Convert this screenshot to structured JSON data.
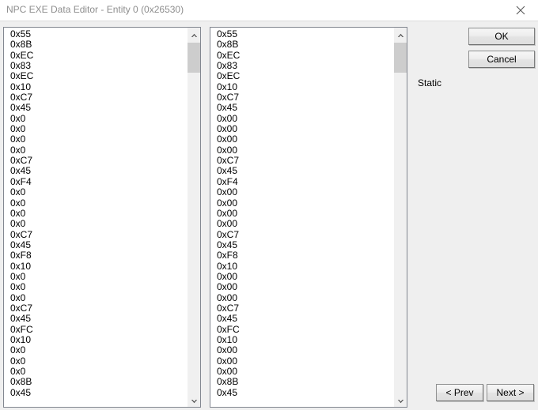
{
  "window": {
    "title": "NPC EXE Data Editor - Entity 0 (0x26530)",
    "close_icon": "close-icon"
  },
  "colors": {
    "window_background": "#efefef",
    "titlebar_background": "#ffffff",
    "title_text": "#8e8e8e",
    "listbox_background": "#ffffff",
    "listbox_border": "#828790",
    "scrollbar_track": "#f0f0f0",
    "scrollbar_thumb": "#cdcdcd",
    "button_face": "#ededed",
    "button_border": "#8e8f8f",
    "text": "#000000"
  },
  "lists": {
    "left": {
      "name": "original-bytes-list",
      "values": [
        "0x55",
        "0x8B",
        "0xEC",
        "0x83",
        "0xEC",
        "0x10",
        "0xC7",
        "0x45",
        "0x0",
        "0x0",
        "0x0",
        "0x0",
        "0xC7",
        "0x45",
        "0xF4",
        "0x0",
        "0x0",
        "0x0",
        "0x0",
        "0xC7",
        "0x45",
        "0xF8",
        "0x10",
        "0x0",
        "0x0",
        "0x0",
        "0xC7",
        "0x45",
        "0xFC",
        "0x10",
        "0x0",
        "0x0",
        "0x0",
        "0x8B",
        "0x45"
      ]
    },
    "right": {
      "name": "edited-bytes-list",
      "values": [
        "0x55",
        "0x8B",
        "0xEC",
        "0x83",
        "0xEC",
        "0x10",
        "0xC7",
        "0x45",
        "0x00",
        "0x00",
        "0x00",
        "0x00",
        "0xC7",
        "0x45",
        "0xF4",
        "0x00",
        "0x00",
        "0x00",
        "0x00",
        "0xC7",
        "0x45",
        "0xF8",
        "0x10",
        "0x00",
        "0x00",
        "0x00",
        "0xC7",
        "0x45",
        "0xFC",
        "0x10",
        "0x00",
        "0x00",
        "0x00",
        "0x8B",
        "0x45"
      ]
    }
  },
  "scrollbars": {
    "up_arrow_icon": "chevron-up-icon",
    "down_arrow_icon": "chevron-down-icon"
  },
  "labels": {
    "static": "Static"
  },
  "buttons": {
    "ok": "OK",
    "cancel": "Cancel",
    "prev": "< Prev",
    "next": "Next >"
  }
}
